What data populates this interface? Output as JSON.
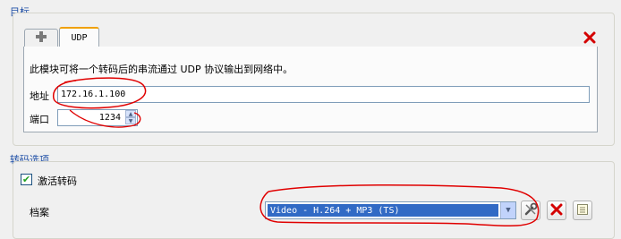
{
  "destination": {
    "group_title": "目标",
    "add_tab_icon": "plus-icon",
    "tab_label": "UDP",
    "remove_icon": "red-x-icon",
    "description": "此模块可将一个转码后的串流通过 UDP 协议输出到网络中。",
    "address_label": "地址",
    "address_value": "172.16.1.100",
    "port_label": "端口",
    "port_value": "1234"
  },
  "transcode": {
    "group_title": "转码选项",
    "activate_label": "激活转码",
    "activate_checked": true,
    "profile_label": "档案",
    "profile_value": "Video - H.264 + MP3 (TS)",
    "edit_icon": "wrench-icon",
    "delete_icon": "red-x-icon",
    "new_icon": "list-icon"
  },
  "annotation_color": "#e00000"
}
